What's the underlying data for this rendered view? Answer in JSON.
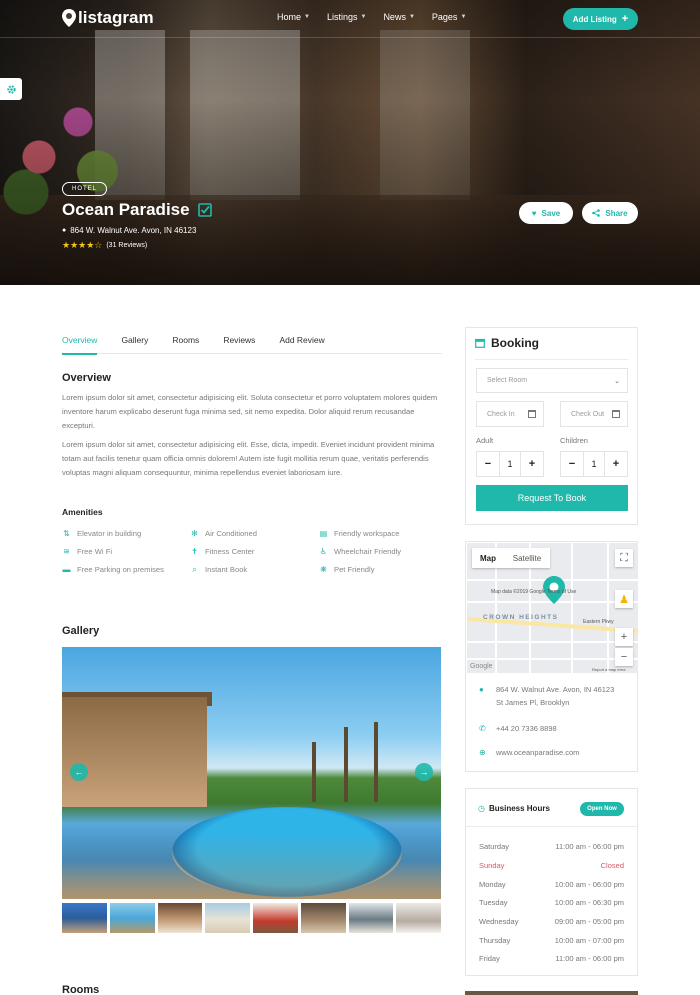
{
  "brand": {
    "name": "listagram",
    "accent": "#20b8aa"
  },
  "nav": {
    "items": [
      "Home",
      "Listings",
      "News",
      "Pages"
    ],
    "add_listing": "Add Listing",
    "add_icon": "plus-icon"
  },
  "hero": {
    "category": "HOTEL",
    "title": "Ocean Paradise",
    "address": "864 W. Walnut Ave. Avon, IN 46123",
    "rating": 4.5,
    "stars": "★★★★☆",
    "reviews": "(31 Reviews)",
    "save": "Save",
    "share": "Share"
  },
  "tabs": [
    "Overview",
    "Gallery",
    "Rooms",
    "Reviews",
    "Add Review"
  ],
  "overview": {
    "title": "Overview",
    "p1": "Lorem ipsum dolor sit amet, consectetur adipisicing elit. Soluta consectetur et porro voluptatem molores quidem inventore harum explicabo deserunt fuga minima sed, sit nemo expedita. Dolor aliquid rerum recusandae excepturi.",
    "p2": "Lorem ipsum dolor sit amet, consectetur adipisicing elit. Esse, dicta, impedit. Eveniet incidunt provident minima totam aut facilis tenetur quam officia omnis dolorem! Autem iste fugit mollitia rerum quae, veritatis perferendis voluptas magni aliquam consequuntur, minima repellendus eveniet laboriosam iure."
  },
  "amenities": {
    "title": "Amenities",
    "items": [
      {
        "label": "Elevator in building",
        "icon": "elevator-icon"
      },
      {
        "label": "Free Wi Fi",
        "icon": "wifi-icon"
      },
      {
        "label": "Free Parking on premises",
        "icon": "car-icon"
      },
      {
        "label": "Air Conditioned",
        "icon": "snowflake-icon"
      },
      {
        "label": "Fitness Center",
        "icon": "fitness-icon"
      },
      {
        "label": "Instant Book",
        "icon": "search-icon"
      },
      {
        "label": "Friendly workspace",
        "icon": "workspace-icon"
      },
      {
        "label": "Wheelchair Friendly",
        "icon": "wheelchair-icon"
      },
      {
        "label": "Pet Friendly",
        "icon": "paw-icon"
      }
    ]
  },
  "gallery": {
    "title": "Gallery",
    "thumb_count": 8
  },
  "rooms": {
    "title": "Rooms"
  },
  "booking": {
    "title": "Booking",
    "select_room": "Select Room",
    "check_in": "Check In",
    "check_out": "Check Out",
    "adult_label": "Adult",
    "children_label": "Children",
    "adult_value": "1",
    "children_value": "1",
    "minus": "−",
    "plus": "+",
    "request": "Request To Book"
  },
  "map": {
    "tab_map": "Map",
    "tab_satellite": "Satellite",
    "area_label": "CROWN HEIGHTS",
    "copyright": "Map data ©2019 Google  Terms of Use",
    "report": "Report a map error",
    "google": "Google",
    "street": "Eastern Pkwy"
  },
  "contact": {
    "address_line1": "864 W. Walnut Ave. Avon, IN 46123",
    "address_line2": "St James Pl, Brooklyn",
    "phone": "+44 20 7336 8898",
    "website": "www.oceanparadise.com"
  },
  "hours": {
    "title": "Business Hours",
    "status": "Open Now",
    "rows": [
      {
        "day": "Saturday",
        "time": "11:00 am - 06:00 pm",
        "closed": false
      },
      {
        "day": "Sunday",
        "time": "Closed",
        "closed": true
      },
      {
        "day": "Monday",
        "time": "10:00 am - 06:00 pm",
        "closed": false
      },
      {
        "day": "Tuesday",
        "time": "10:00 am - 06:30 pm",
        "closed": false
      },
      {
        "day": "Wednesday",
        "time": "09:00 am - 05:00 pm",
        "closed": false
      },
      {
        "day": "Thursday",
        "time": "10:00 am - 07:00 pm",
        "closed": false
      },
      {
        "day": "Friday",
        "time": "11:00 am - 06:00 pm",
        "closed": false
      }
    ]
  }
}
